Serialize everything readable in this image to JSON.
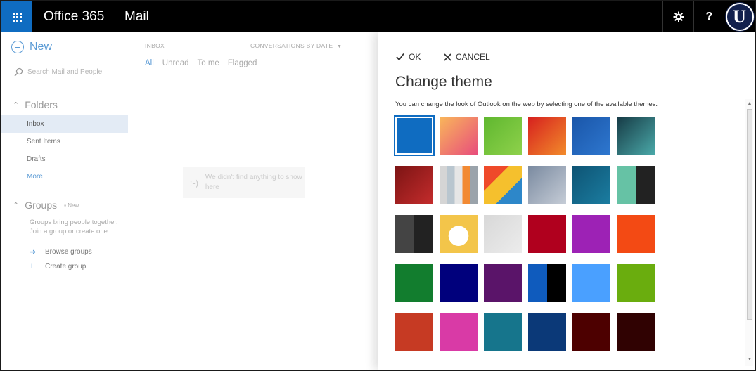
{
  "header": {
    "app_title": "Office 365",
    "module_title": "Mail",
    "help_label": "?",
    "avatar_letter": "U"
  },
  "leftnav": {
    "new_label": "New",
    "search_placeholder": "Search Mail and People",
    "folders_label": "Folders",
    "folders": [
      {
        "label": "Inbox",
        "active": true
      },
      {
        "label": "Sent Items"
      },
      {
        "label": "Drafts"
      },
      {
        "label": "More"
      }
    ],
    "groups_label": "Groups",
    "groups_new_badge": "New",
    "groups_desc": "Groups bring people together. Join a group or create one.",
    "browse_groups": "Browse groups",
    "create_group": "Create group"
  },
  "messagelist": {
    "folder_label": "INBOX",
    "sort_label": "CONVERSATIONS BY DATE",
    "filters": [
      "All",
      "Unread",
      "To me",
      "Flagged"
    ],
    "empty_face": ":-)",
    "empty_text": "We didn't find anything to show here"
  },
  "theme_panel": {
    "ok_label": "OK",
    "cancel_label": "CANCEL",
    "title": "Change theme",
    "description": "You can change the look of Outlook on the web by selecting one of the available themes.",
    "themes": [
      {
        "name": "blue",
        "selected": true,
        "colors": [
          "#0f6cc1"
        ]
      },
      {
        "name": "springtime",
        "colors": [
          "#f9b75a",
          "#e84d7c"
        ]
      },
      {
        "name": "grass",
        "colors": [
          "#5fb72f",
          "#8ed14b"
        ]
      },
      {
        "name": "paint",
        "colors": [
          "#d6201e",
          "#f28b2b"
        ]
      },
      {
        "name": "blueprint",
        "colors": [
          "#1a56a9",
          "#2e77cf"
        ]
      },
      {
        "name": "circuit",
        "colors": [
          "#163a45",
          "#4aa8a8"
        ]
      },
      {
        "name": "red-abstract",
        "colors": [
          "#7c1414",
          "#c42c2c"
        ]
      },
      {
        "name": "stripes",
        "colors": [
          "#c9c9c9",
          "#f28a33"
        ]
      },
      {
        "name": "geometric",
        "colors": [
          "#ef4a2a",
          "#f5c02d",
          "#2d87c9"
        ]
      },
      {
        "name": "denim",
        "colors": [
          "#7a8aa0",
          "#c5ccd6"
        ]
      },
      {
        "name": "deep-sea",
        "colors": [
          "#0e5474",
          "#1b7da1"
        ]
      },
      {
        "name": "split-teal",
        "colors": [
          "#66c2a5",
          "#222"
        ]
      },
      {
        "name": "split-grey",
        "colors": [
          "#444",
          "#222"
        ]
      },
      {
        "name": "lucky-cat",
        "colors": [
          "#f3c54a",
          "#fff"
        ]
      },
      {
        "name": "snowflakes",
        "colors": [
          "#d8d8d8",
          "#ececec"
        ]
      },
      {
        "name": "red",
        "colors": [
          "#b0001e"
        ]
      },
      {
        "name": "purple",
        "colors": [
          "#9d22b5"
        ]
      },
      {
        "name": "orange",
        "colors": [
          "#f34a14"
        ]
      },
      {
        "name": "green",
        "colors": [
          "#127d2e"
        ]
      },
      {
        "name": "navy",
        "colors": [
          "#00007c"
        ]
      },
      {
        "name": "dark-purple",
        "colors": [
          "#5a1469"
        ]
      },
      {
        "name": "blue-black",
        "colors": [
          "#0f5bbd",
          "#000"
        ]
      },
      {
        "name": "sky",
        "colors": [
          "#4aa0ff"
        ]
      },
      {
        "name": "lime",
        "colors": [
          "#6aad0e"
        ]
      },
      {
        "name": "rust",
        "colors": [
          "#c63a23"
        ]
      },
      {
        "name": "magenta",
        "colors": [
          "#d93aa6"
        ]
      },
      {
        "name": "teal",
        "colors": [
          "#16758c"
        ]
      },
      {
        "name": "deep-blue",
        "colors": [
          "#0b3978"
        ]
      },
      {
        "name": "maroon",
        "colors": [
          "#4d0000"
        ]
      },
      {
        "name": "dark-maroon",
        "colors": [
          "#300202"
        ]
      }
    ]
  }
}
